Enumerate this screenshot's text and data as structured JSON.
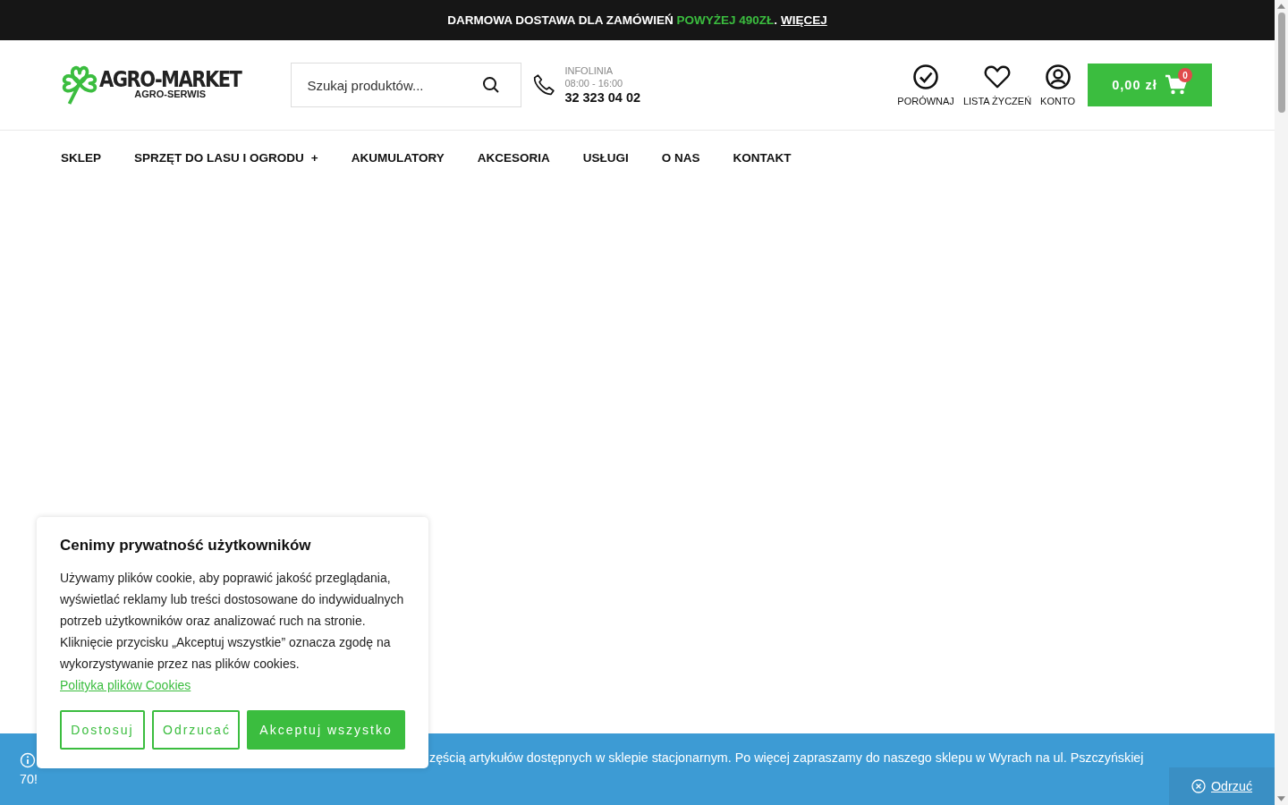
{
  "promo_bar": {
    "text": "DARMOWA DOSTAWA DLA ZAMÓWIEŃ ",
    "highlight": "POWYŻEJ 490ZŁ",
    "separator": ".",
    "link": "WIĘCEJ"
  },
  "header": {
    "logo": {
      "name": "AGRO-MARKET",
      "subtitle": "AGRO-SERWIS"
    },
    "search": {
      "placeholder": "Szukaj produktów..."
    },
    "hotline": {
      "label": "INFOLINIA",
      "hours": "08:00 - 16:00",
      "phone": "32 323 04 02"
    },
    "actions": [
      {
        "kind": "compare",
        "label": "PORÓWNAJ"
      },
      {
        "kind": "wishlist",
        "label": "LISTA ŻYCZEŃ"
      },
      {
        "kind": "account",
        "label": "KONTO"
      }
    ],
    "cart": {
      "total": "0,00 zł",
      "count": "0"
    }
  },
  "nav": [
    {
      "label": "SKLEP",
      "has_submenu": false
    },
    {
      "label": "SPRZĘT DO LASU I OGRODU",
      "has_submenu": true,
      "toggle": "+"
    },
    {
      "label": "AKUMULATORY",
      "has_submenu": false
    },
    {
      "label": "AKCESORIA",
      "has_submenu": false
    },
    {
      "label": "USŁUGI",
      "has_submenu": false
    },
    {
      "label": "O NAS",
      "has_submenu": false
    },
    {
      "label": "KONTAKT",
      "has_submenu": false
    }
  ],
  "notice": {
    "lines": [
      "zęścią artykułów dostępnych w sklepie stacjonarnym. Po więcej zapraszamy do naszego sklepu w Wyrach na ul. Pszczyńskiej",
      "70!"
    ],
    "dismiss": "Odrzuć"
  },
  "cookie_popup": {
    "title": "Cenimy prywatność użytkowników",
    "body": "Używamy plików cookie, aby poprawić jakość przeglądania, wyświetlać reklamy lub treści dostosowane do indywidualnych potrzeb użytkowników oraz analizować ruch na stronie. Kliknięcie przycisku „Akceptuj wszystkie” oznacza zgodę na wykorzystywanie przez nas plików cookies.",
    "link": "Polityka plików Cookies",
    "buttons": [
      {
        "label": "Dostosuj",
        "kind": "outline"
      },
      {
        "label": "Odrzucać",
        "kind": "outline"
      },
      {
        "label": "Akceptuj wszystko",
        "kind": "primary"
      }
    ]
  }
}
